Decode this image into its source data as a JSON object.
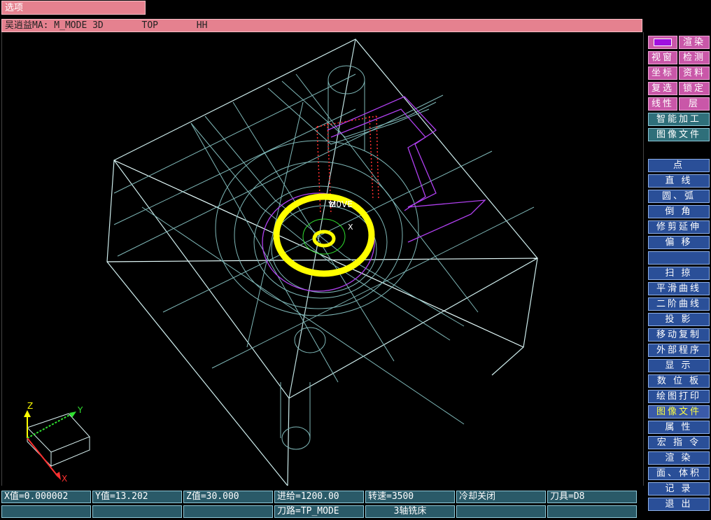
{
  "menu": {
    "label": "选项"
  },
  "titlebar": {
    "text": "吴逍益MA: M_MODE 3D       TOP       HH"
  },
  "viewport": {
    "labels": {
      "origin": "M0VE",
      "x_mark": "X",
      "z_mark": "Z",
      "y_mark": "Y"
    },
    "triad": {
      "z": "Z",
      "y": "Y",
      "x": "X"
    },
    "colors": {
      "wire": "#d8f0f0",
      "dim": "#7fb8b8",
      "purple": "#b040f0",
      "yellow": "#ffff00",
      "red": "#ff3030",
      "green": "#30e030"
    }
  },
  "toolbar_top": {
    "render_label": "渲染",
    "rows": [
      [
        "视窗",
        "检测"
      ],
      [
        "坐标",
        "资料"
      ],
      [
        "复选",
        "锁定"
      ],
      [
        "线性",
        "层"
      ]
    ],
    "smart_machining": "智能加工",
    "image_file": "图像文件"
  },
  "toolbar_main": [
    "点",
    "直 线",
    "圆、弧",
    "倒 角",
    "修剪延伸",
    "偏 移",
    "",
    "扫 掠",
    "平滑曲线",
    "二阶曲线",
    "投 影",
    "移动复制",
    "外部程序",
    "显 示",
    "数 位 板",
    "绘图打印",
    "图像文件",
    "属 性",
    "宏 指 令",
    "渲 染",
    "面、体积",
    "记 录",
    "退 出"
  ],
  "toolbar_main_active_index": 16,
  "status": {
    "x_value": "X值=0.000002",
    "y_value": "Y值=13.202",
    "z_value": "Z值=30.000",
    "feed": "进给=1200.00",
    "spindle": "转速=3500",
    "coolant": "冷却关闭",
    "tool": "刀具=D8",
    "toolpath": "刀路=TP_MODE",
    "machine": "3轴铣床"
  }
}
